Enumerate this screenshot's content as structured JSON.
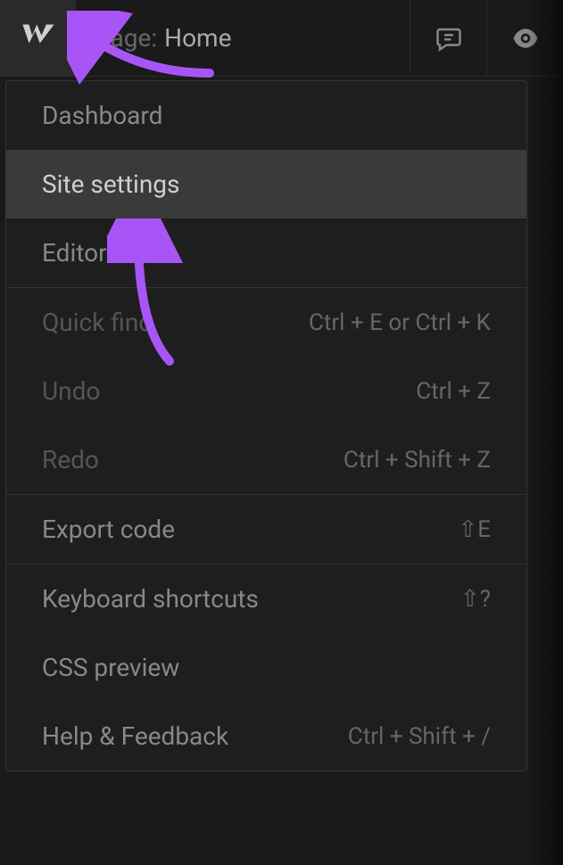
{
  "topbar": {
    "breadcrumb_label": "Page:",
    "breadcrumb_value": "Home"
  },
  "menu": {
    "items": [
      {
        "label": "Dashboard",
        "shortcut": "",
        "active": false
      },
      {
        "label": "Site settings",
        "shortcut": "",
        "active": true
      },
      {
        "label": "Editor",
        "shortcut": "",
        "active": false
      },
      {
        "label": "Quick find",
        "shortcut": "Ctrl + E or Ctrl + K",
        "active": false
      },
      {
        "label": "Undo",
        "shortcut": "Ctrl + Z",
        "active": false
      },
      {
        "label": "Redo",
        "shortcut": "Ctrl + Shift + Z",
        "active": false
      },
      {
        "label": "Export code",
        "shortcut": "⇧E",
        "active": false
      },
      {
        "label": "Keyboard shortcuts",
        "shortcut": "⇧?",
        "active": false
      },
      {
        "label": "CSS preview",
        "shortcut": "",
        "active": false
      },
      {
        "label": "Help & Feedback",
        "shortcut": "Ctrl + Shift + /",
        "active": false
      }
    ]
  },
  "annotation": {
    "color": "#a855f7"
  }
}
